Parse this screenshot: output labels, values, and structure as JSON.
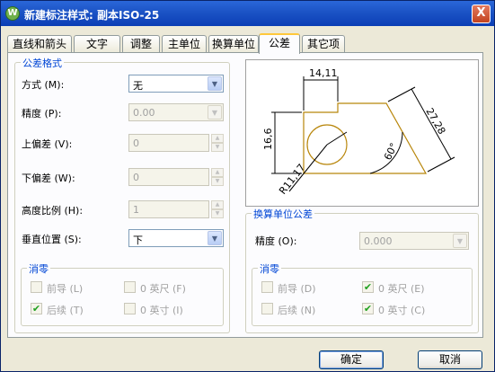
{
  "window": {
    "title": "新建标注样式: 副本ISO-25",
    "app_icon": "W",
    "close_label": "X"
  },
  "tabs": [
    "直线和箭头",
    "文字",
    "调整",
    "主单位",
    "换算单位",
    "公差",
    "其它项"
  ],
  "active_tab": "公差",
  "tolerance_format": {
    "legend": "公差格式",
    "method_label": "方式 (M):",
    "method_value": "无",
    "precision_label": "精度 (P):",
    "precision_value": "0.00",
    "upper_label": "上偏差 (V):",
    "upper_value": "0",
    "lower_label": "下偏差 (W):",
    "lower_value": "0",
    "height_label": "高度比例 (H):",
    "height_value": "1",
    "vpos_label": "垂直位置 (S):",
    "vpos_value": "下"
  },
  "zero_left": {
    "legend": "消零",
    "leading": "前导 (L)",
    "trailing": "后续 (T)",
    "feet": "0 英尺 (F)",
    "inches": "0 英寸 (I)",
    "leading_checked": false,
    "trailing_checked": true,
    "feet_checked": false,
    "inches_checked": false
  },
  "preview": {
    "dim_top": "14,11",
    "dim_left": "16,6",
    "dim_right": "27,28",
    "angle": "60°",
    "radius": "R11,17"
  },
  "alt_unit_tolerance": {
    "legend": "换算单位公差",
    "precision_label": "精度 (O):",
    "precision_value": "0.000",
    "zero_legend": "消零",
    "leading": "前导 (D)",
    "trailing": "后续 (N)",
    "feet": "0 英尺 (E)",
    "inches": "0 英寸 (C)",
    "leading_checked": false,
    "trailing_checked": false,
    "feet_checked": true,
    "inches_checked": true
  },
  "buttons": {
    "ok": "确定",
    "cancel": "取消"
  },
  "colors": {
    "title_bar": "#0b3eb5",
    "group_legend": "#0046d5",
    "active_tab_highlight": "#ffc83c",
    "preview_geometry": "#b8860b"
  }
}
